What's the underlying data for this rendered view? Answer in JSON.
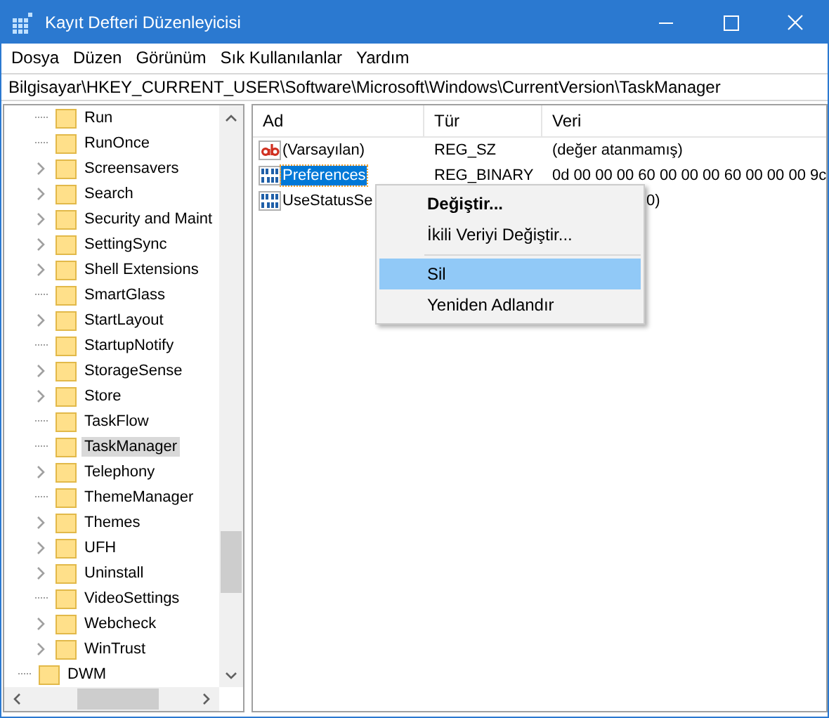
{
  "window": {
    "title": "Kayıt Defteri Düzenleyicisi"
  },
  "menu_bar": [
    "Dosya",
    "Düzen",
    "Görünüm",
    "Sık Kullanılanlar",
    "Yardım"
  ],
  "address": "Bilgisayar\\HKEY_CURRENT_USER\\Software\\Microsoft\\Windows\\CurrentVersion\\TaskManager",
  "tree": [
    {
      "children": [
        {
          "label": "Run",
          "expandable": false,
          "selected": false
        },
        {
          "label": "RunOnce",
          "expandable": false,
          "selected": false
        },
        {
          "label": "Screensavers",
          "expandable": true,
          "selected": false
        },
        {
          "label": "Search",
          "expandable": true,
          "selected": false
        },
        {
          "label": "Security and Maint",
          "expandable": true,
          "selected": false
        },
        {
          "label": "SettingSync",
          "expandable": true,
          "selected": false
        },
        {
          "label": "Shell Extensions",
          "expandable": true,
          "selected": false
        },
        {
          "label": "SmartGlass",
          "expandable": false,
          "selected": false
        },
        {
          "label": "StartLayout",
          "expandable": true,
          "selected": false
        },
        {
          "label": "StartupNotify",
          "expandable": false,
          "selected": false
        },
        {
          "label": "StorageSense",
          "expandable": true,
          "selected": false
        },
        {
          "label": "Store",
          "expandable": true,
          "selected": false
        },
        {
          "label": "TaskFlow",
          "expandable": false,
          "selected": false
        },
        {
          "label": "TaskManager",
          "expandable": false,
          "selected": true
        },
        {
          "label": "Telephony",
          "expandable": true,
          "selected": false
        },
        {
          "label": "ThemeManager",
          "expandable": false,
          "selected": false
        },
        {
          "label": "Themes",
          "expandable": true,
          "selected": false
        },
        {
          "label": "UFH",
          "expandable": true,
          "selected": false
        },
        {
          "label": "Uninstall",
          "expandable": true,
          "selected": false
        },
        {
          "label": "VideoSettings",
          "expandable": false,
          "selected": false
        },
        {
          "label": "Webcheck",
          "expandable": true,
          "selected": false
        },
        {
          "label": "WinTrust",
          "expandable": true,
          "selected": false
        }
      ]
    },
    {
      "label": "DWM",
      "expandable": false,
      "selected": false
    }
  ],
  "table": {
    "columns": [
      "Ad",
      "Tür",
      "Veri"
    ],
    "rows": [
      {
        "kind": "string",
        "name": "(Varsayılan)",
        "type": "REG_SZ",
        "data": "(değer atanmamış)",
        "selected": false
      },
      {
        "kind": "binary",
        "name": "Preferences",
        "type": "REG_BINARY",
        "data": "0d 00 00 00 60 00 00 00 60 00 00 00 9c",
        "selected": true
      },
      {
        "kind": "binary",
        "name": "UseStatusSe",
        "data": "0)",
        "selected": false
      }
    ]
  },
  "context_menu": [
    {
      "kind": "item",
      "label": "Değiştir...",
      "default": true,
      "selected": false
    },
    {
      "kind": "item",
      "label": "İkili Veriyi Değiştir...",
      "default": false,
      "selected": false
    },
    {
      "kind": "separator"
    },
    {
      "kind": "item",
      "label": "Sil",
      "default": false,
      "selected": true
    },
    {
      "kind": "item",
      "label": "Yeniden Adlandır",
      "default": false,
      "selected": false
    }
  ]
}
